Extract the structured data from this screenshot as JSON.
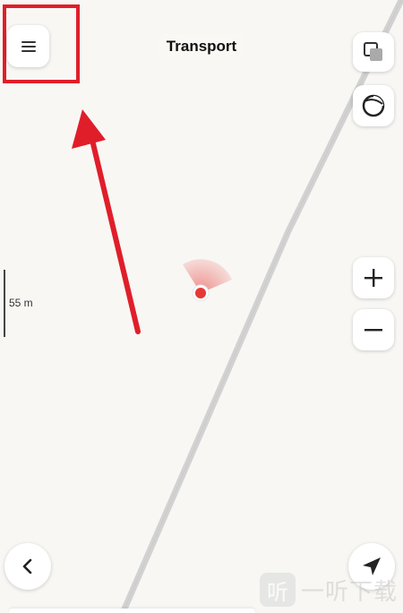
{
  "header": {
    "title": "Transport"
  },
  "map": {
    "scale_label": "55 m",
    "road_color": "#d2d2d2",
    "background_color": "#f8f7f4",
    "position_marker_color": "#e53935"
  },
  "controls": {
    "menu_icon": "hamburger-menu-icon",
    "layers_icon": "layers-icon",
    "compass_icon": "compass-icon",
    "zoom_in_icon": "plus-icon",
    "zoom_out_icon": "minus-icon",
    "back_icon": "chevron-left-icon",
    "locate_icon": "navigation-arrow-icon"
  },
  "annotation": {
    "highlight_color": "#e01e2a",
    "arrow_color": "#e01e2a"
  },
  "watermark": {
    "logo_glyph": "听",
    "text": "一听下载"
  }
}
